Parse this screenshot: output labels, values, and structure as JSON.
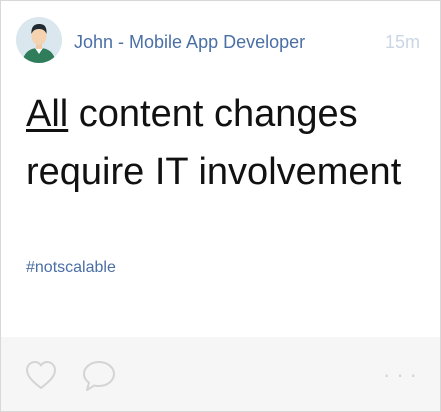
{
  "post": {
    "author": "John - Mobile App Developer",
    "time": "15m",
    "text_emphasis": "All",
    "text_rest": " content changes require IT involvement",
    "hashtag": "#notscalable"
  },
  "actions": {
    "more_label": "···"
  },
  "icons": {
    "avatar": "avatar-icon",
    "like": "heart-icon",
    "comment": "comment-bubble-icon",
    "more": "more-dots-icon"
  },
  "colors": {
    "link": "#4a6fa5",
    "time": "#c9d6e3",
    "text": "#111111",
    "footer_bg": "#f6f6f6",
    "icon_stroke": "#d4d4d4"
  }
}
